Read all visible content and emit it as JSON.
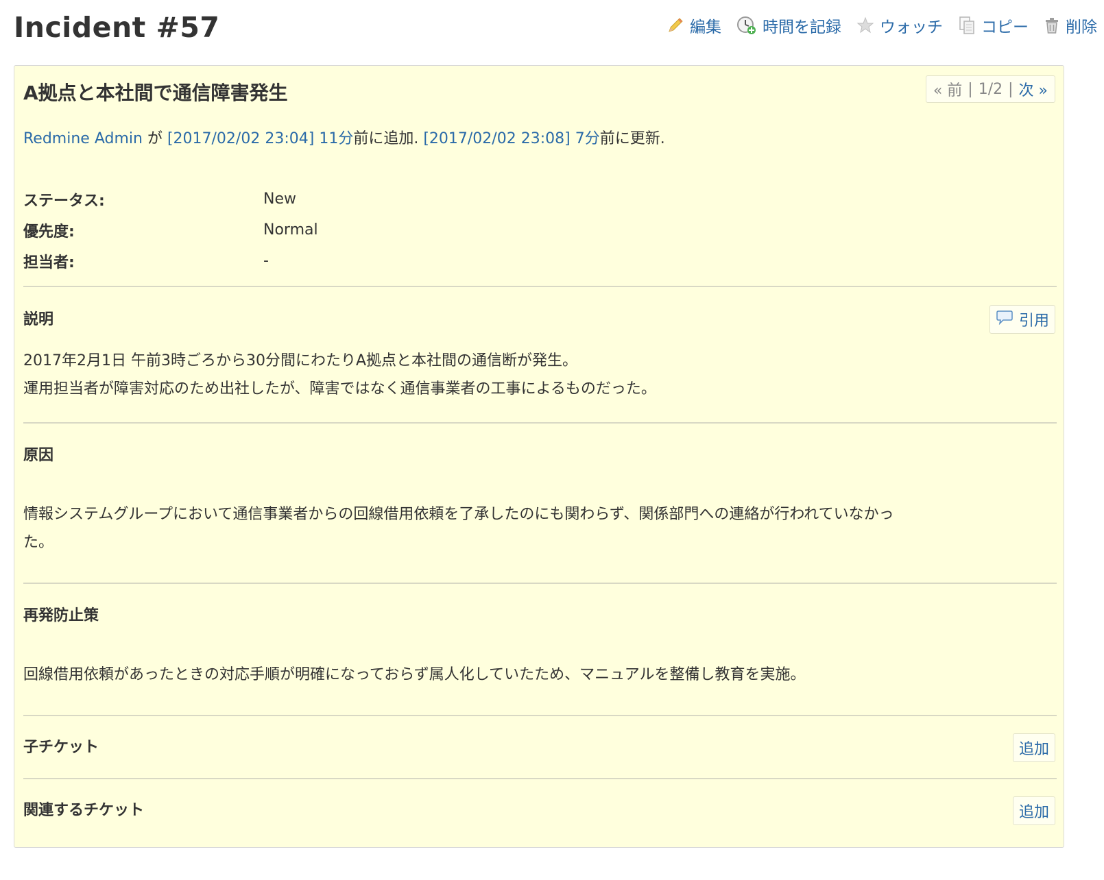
{
  "header": {
    "title": "Incident #57",
    "actions": [
      {
        "label": "編集",
        "icon": "pencil-icon"
      },
      {
        "label": "時間を記録",
        "icon": "clock-add-icon"
      },
      {
        "label": "ウォッチ",
        "icon": "star-icon"
      },
      {
        "label": "コピー",
        "icon": "copy-icon"
      },
      {
        "label": "削除",
        "icon": "trash-icon"
      }
    ]
  },
  "nav": {
    "prev": "« 前",
    "sep1": "|",
    "position": "1/2",
    "sep2": "|",
    "next": "次 »"
  },
  "issue": {
    "subject": "A拠点と本社間で通信障害発生",
    "author": {
      "name": "Redmine Admin",
      "by": "が",
      "created_at": "[2017/02/02 23:04]",
      "created_ago": "11分",
      "added_suffix": "前に追加.",
      "updated_at": "[2017/02/02 23:08]",
      "updated_ago": "7分",
      "updated_suffix": "前に更新."
    },
    "attributes": [
      {
        "label": "ステータス:",
        "value": "New"
      },
      {
        "label": "優先度:",
        "value": "Normal"
      },
      {
        "label": "担当者:",
        "value": "-"
      }
    ],
    "description": {
      "title": "説明",
      "quote_label": "引用",
      "lines": [
        "2017年2月1日 午前3時ごろから30分間にわたりA拠点と本社間の通信断が発生。",
        "運用担当者が障害対応のため出社したが、障害ではなく通信事業者の工事によるものだった。"
      ]
    },
    "cause": {
      "title": "原因",
      "lines": [
        "情報システムグループにおいて通信事業者からの回線借用依頼を了承したのにも関わらず、関係部門への連絡が行われていなかっ",
        "た。"
      ]
    },
    "prevention": {
      "title": "再発防止策",
      "lines": [
        "回線借用依頼があったときの対応手順が明確になっておらず属人化していたため、マニュアルを整備し教育を実施。"
      ]
    },
    "subtasks": {
      "title": "子チケット",
      "add_label": "追加"
    },
    "relations": {
      "title": "関連するチケット",
      "add_label": "追加"
    }
  },
  "colors": {
    "link": "#2a6aa8",
    "issue_background": "#ffffdd",
    "border": "#d7d7d7"
  }
}
